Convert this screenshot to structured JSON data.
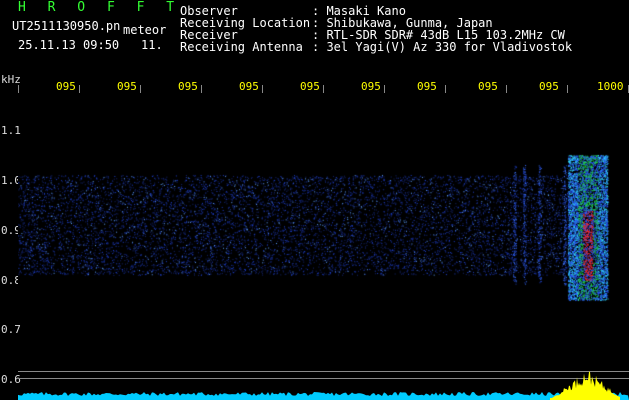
{
  "app": {
    "title": "H R O F F T"
  },
  "file": {
    "filename": "UT2511130950.pn",
    "filename_suffix": "meteor",
    "datetime": "25.11.13 09:50",
    "index": "11."
  },
  "info": {
    "labels": [
      "Observer",
      "Receiving Location",
      "Receiver",
      "Receiving Antenna"
    ],
    "values": [
      ": Masaki Kano",
      ": Shibukawa, Gunma, Japan",
      ": RTL-SDR SDR# 43dB L15 103.2MHz CW",
      ": 3el Yagi(V) Az 330 for Vladivostok"
    ]
  },
  "axes": {
    "y_unit": "kHz",
    "y_ticks": [
      "1.1",
      "1.0",
      "0.9",
      "0.8",
      "0.7",
      "0.6"
    ],
    "x_ticks": [
      "095",
      "095",
      "095",
      "095",
      "095",
      "095",
      "095",
      "095",
      "095",
      "1000"
    ]
  },
  "colors": {
    "noise": "#1e3ec8",
    "signal_hot": "#ff2a2a",
    "signal_mid": "#22dd44",
    "signal_cyan": "#33e0ff",
    "baseline": "#00ccff",
    "peak": "#ffff00",
    "guide_line": "#aaaaaa"
  },
  "spectrogram": {
    "x_range": [
      0,
      1000
    ],
    "y_range_khz": [
      0.79,
      1.04
    ],
    "signal_x_from": 900,
    "signal_x_to": 965
  }
}
